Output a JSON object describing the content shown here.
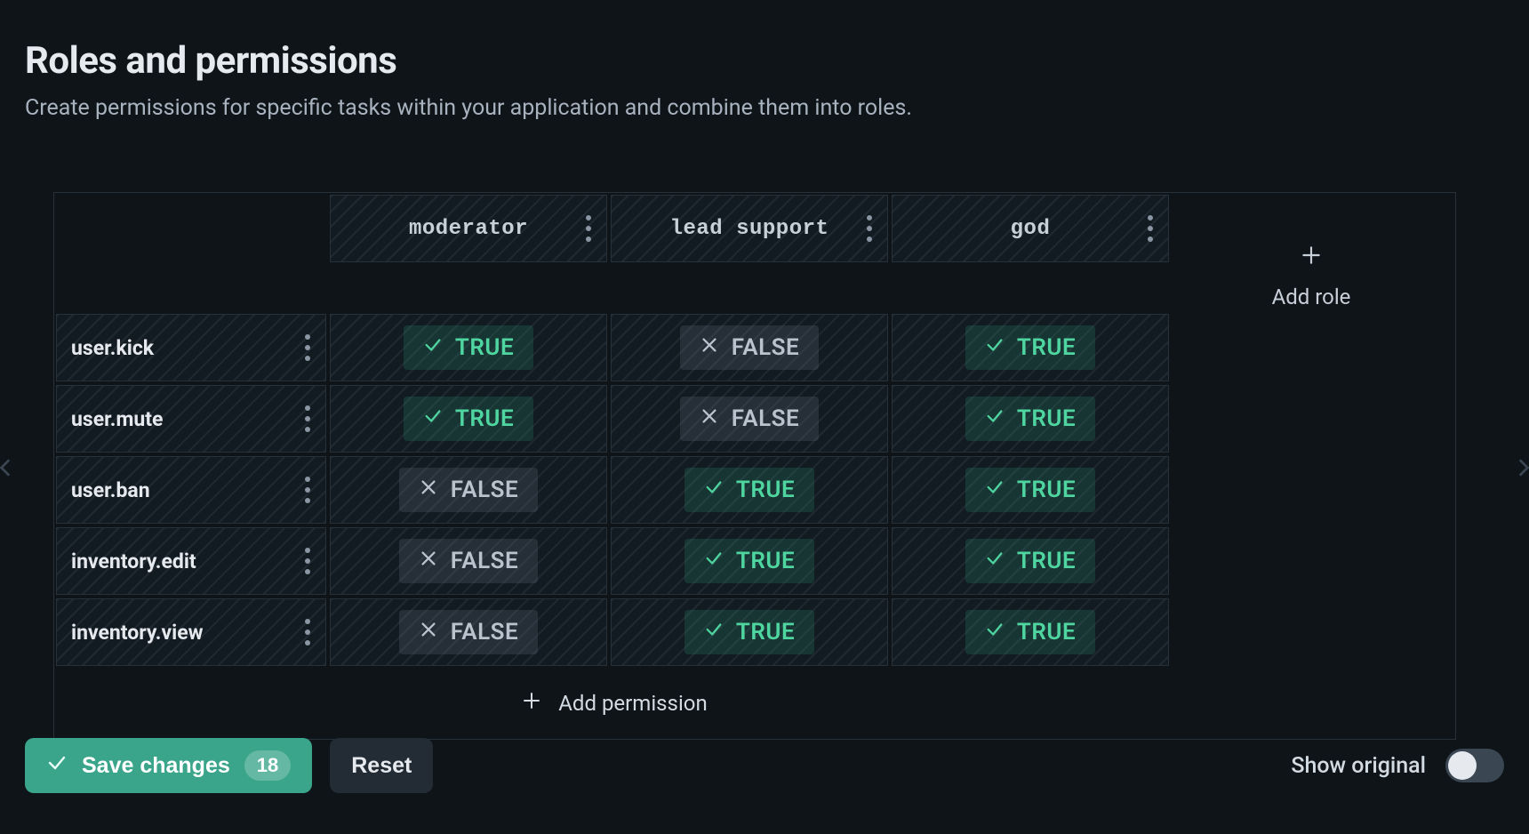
{
  "header": {
    "title": "Roles and permissions",
    "subtitle": "Create permissions for specific tasks within your application and combine them into roles."
  },
  "table": {
    "roles": [
      "moderator",
      "lead support",
      "god"
    ],
    "permissions": [
      "user.kick",
      "user.mute",
      "user.ban",
      "inventory.edit",
      "inventory.view"
    ],
    "matrix": [
      [
        true,
        false,
        true
      ],
      [
        true,
        false,
        true
      ],
      [
        false,
        true,
        true
      ],
      [
        false,
        true,
        true
      ],
      [
        false,
        true,
        true
      ]
    ],
    "true_label": "TRUE",
    "false_label": "FALSE",
    "add_role_label": "Add role",
    "add_permission_label": "Add permission"
  },
  "actions": {
    "save_label": "Save changes",
    "save_count": "18",
    "reset_label": "Reset",
    "show_original_label": "Show original",
    "show_original_on": false
  }
}
